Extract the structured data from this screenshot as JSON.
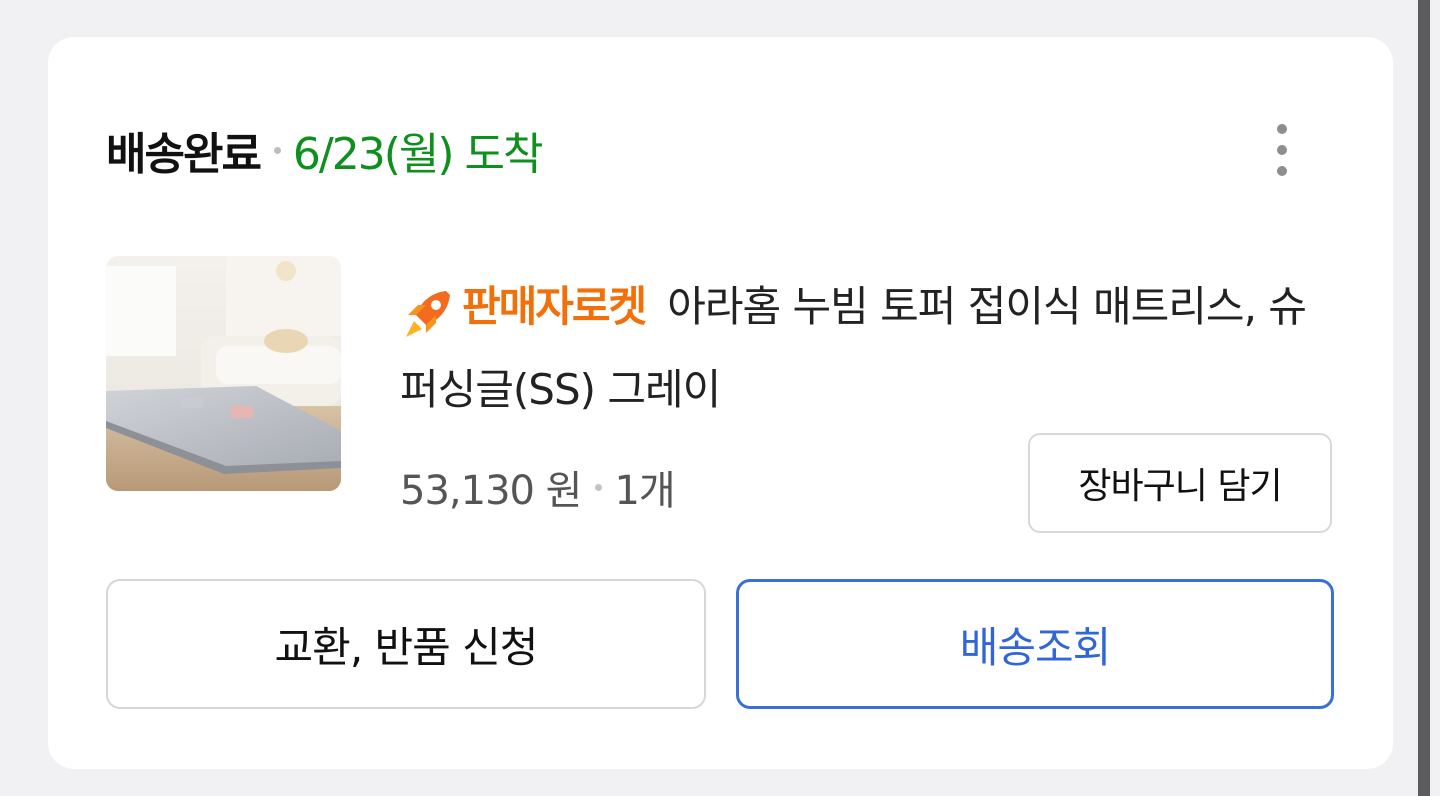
{
  "order": {
    "status": "배송완료",
    "arrival": "6/23(월) 도착",
    "more_icon": "more-vertical-icon"
  },
  "product": {
    "badge_icon": "rocket-icon",
    "badge_label": "판매자로켓",
    "name": "아라홈 누빔 토퍼 접이식 매트리스, 슈퍼싱글(SS) 그레이",
    "price": "53,130 원",
    "quantity": "1개",
    "image": "mattress-topper-thumbnail"
  },
  "buttons": {
    "cart": "장바구니 담기",
    "exchange_return": "교환, 반품 신청",
    "track_delivery": "배송조회"
  },
  "colors": {
    "arrival_green": "#0f8f1e",
    "rocket_orange": "#f2700a",
    "primary_blue": "#3266d6",
    "background": "#f1f1f3"
  }
}
